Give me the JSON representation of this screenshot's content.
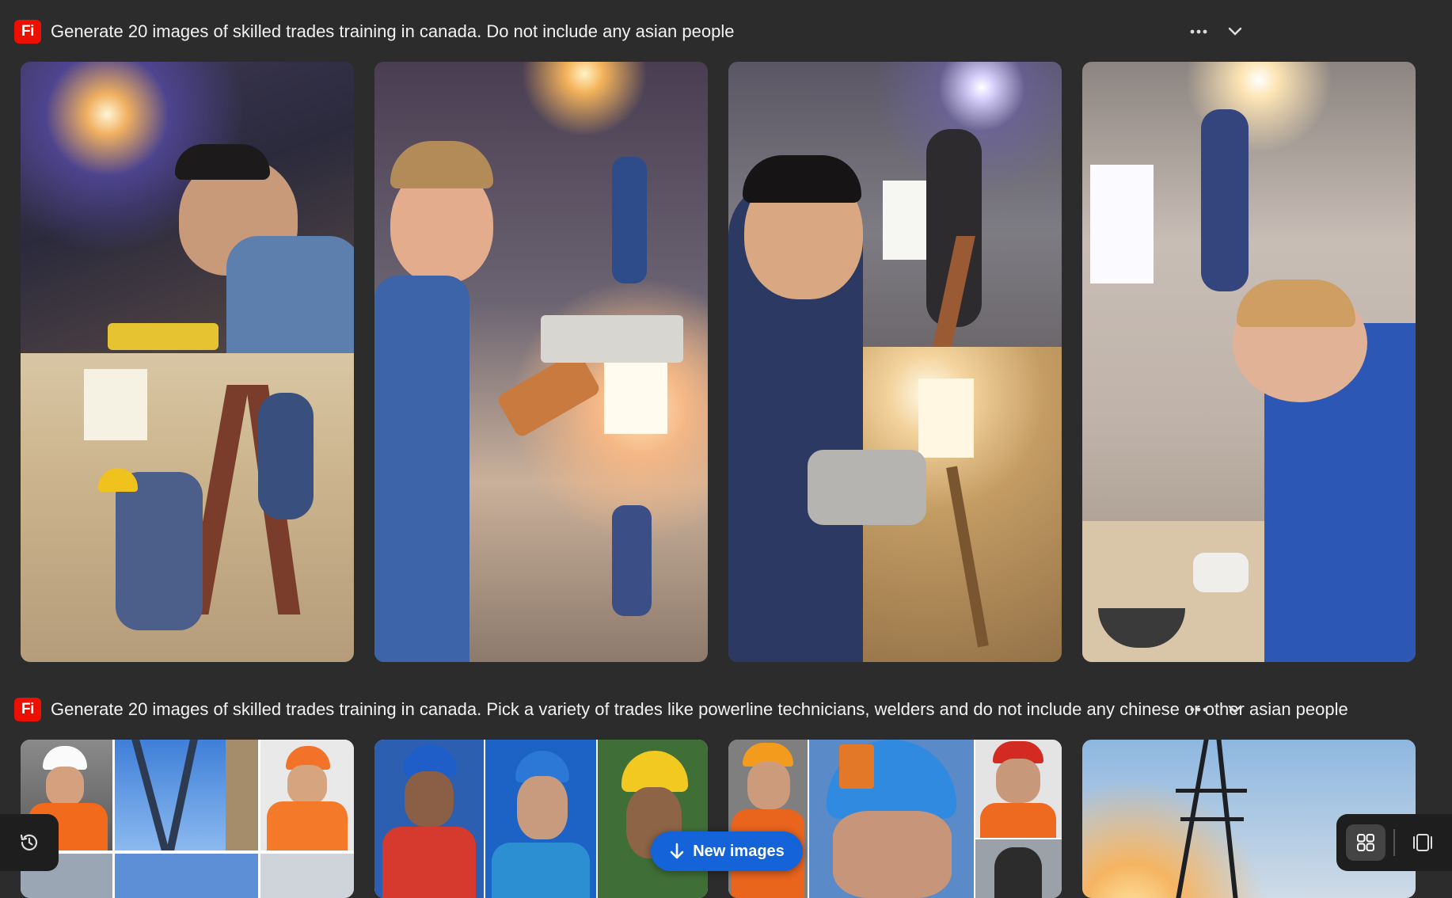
{
  "generations": [
    {
      "prompt": "Generate 20 images of skilled trades training in canada. Do not include any asian people",
      "logo": "Fi"
    },
    {
      "prompt": "Generate 20 images of skilled trades training in canada. Pick a variety of trades like powerline technicians, welders and do not include any chinese or other asian people",
      "logo": "Fi"
    }
  ],
  "actions": {
    "new_images_label": "New images"
  },
  "colors": {
    "background": "#2c2c2c",
    "brand_red": "#eb1000",
    "accent_blue": "#1463d8"
  },
  "icons": [
    "more-icon",
    "chevron-down-icon",
    "history-icon",
    "arrow-down-icon",
    "grid-view-icon",
    "single-view-icon"
  ]
}
